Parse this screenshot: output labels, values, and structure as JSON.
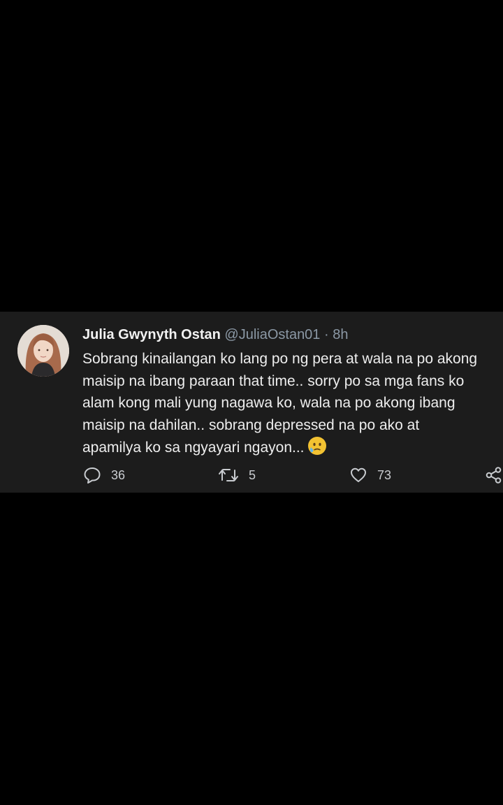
{
  "tweet": {
    "author_name": "Julia Gwynyth Ostan",
    "handle": "@JuliaOstan01",
    "separator": "·",
    "time": "8h",
    "text_lines": [
      "Sobrang kinailangan ko lang po ng pera at wala na po akong",
      "maisip na ibang paraan that time.. sorry po sa mga fans ko",
      "alam kong mali yung nagawa ko, wala na po akong ibang",
      "maisip na dahilan.. sobrang depressed na po ako at",
      "apamilya ko sa ngyayari ngayon..."
    ],
    "emoji": "sad-tear-face-emoji",
    "actions": {
      "reply": {
        "icon": "reply-bubble-icon",
        "count": "36"
      },
      "retweet": {
        "icon": "retweet-icon",
        "count": "5"
      },
      "like": {
        "icon": "heart-icon",
        "count": "73"
      },
      "share": {
        "icon": "share-icon"
      }
    }
  },
  "colors": {
    "page_background": "#000000",
    "card_background": "#1c1c1c",
    "name_text": "#f2f2f2",
    "muted_text": "#8b98a5",
    "body_text": "#eeeeee",
    "icon_color": "#c9ccd0"
  }
}
